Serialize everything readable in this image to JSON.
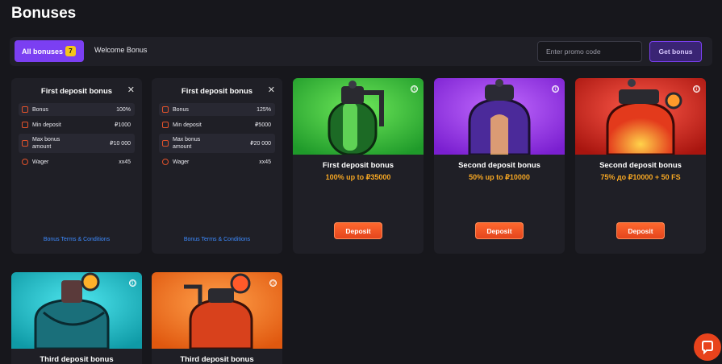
{
  "page": {
    "title": "Bonuses"
  },
  "filters": {
    "all_label": "All bonuses",
    "all_count": "7",
    "welcome_label": "Welcome Bonus",
    "promo_placeholder": "Enter promo code",
    "get_bonus_label": "Get bonus"
  },
  "details": [
    {
      "title": "First deposit bonus",
      "rows": [
        {
          "label": "Bonus",
          "value": "100%",
          "icon": "gift-icon"
        },
        {
          "label": "Min deposit",
          "value": "₽1000",
          "icon": "wallet-icon"
        },
        {
          "label": "Max bonus amount",
          "value": "₽10 000",
          "icon": "wallet-icon"
        },
        {
          "label": "Wager",
          "value": "xx45",
          "icon": "clock-icon"
        }
      ],
      "terms": "Bonus Terms & Conditions"
    },
    {
      "title": "First deposit bonus",
      "rows": [
        {
          "label": "Bonus",
          "value": "125%",
          "icon": "gift-icon"
        },
        {
          "label": "Min deposit",
          "value": "₽5000",
          "icon": "wallet-icon"
        },
        {
          "label": "Max bonus amount",
          "value": "₽20 000",
          "icon": "wallet-icon"
        },
        {
          "label": "Wager",
          "value": "xx45",
          "icon": "clock-icon"
        }
      ],
      "terms": "Bonus Terms & Conditions"
    }
  ],
  "cards": [
    {
      "title": "First deposit bonus",
      "subtitle": "100% up to ₽35000",
      "button": "Deposit",
      "color": "#2fbf3a"
    },
    {
      "title": "Second deposit bonus",
      "subtitle": "50% up to ₽10000",
      "button": "Deposit",
      "color": "#8a2fe0"
    },
    {
      "title": "Second deposit bonus",
      "subtitle": "75% до ₽10000 + 50 FS",
      "button": "Deposit",
      "color": "#d4231c"
    },
    {
      "title": "Third deposit bonus",
      "color": "#16b8c4"
    },
    {
      "title": "Third deposit bonus",
      "color": "#f0701c"
    }
  ],
  "icons": {
    "info": "ⓘ"
  }
}
